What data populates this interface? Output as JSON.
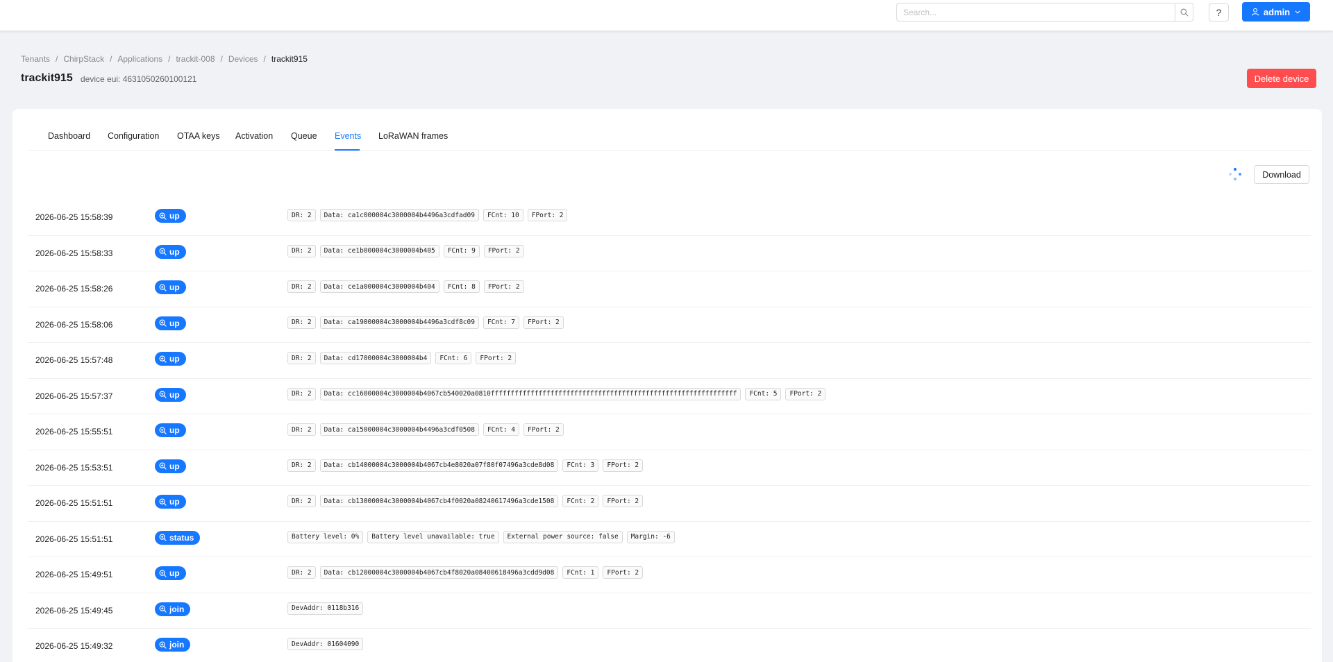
{
  "header": {
    "search_placeholder": "Search...",
    "help_label": "?",
    "user_label": "admin"
  },
  "breadcrumb": [
    "Tenants",
    "ChirpStack",
    "Applications",
    "trackit-008",
    "Devices",
    "trackit915"
  ],
  "page": {
    "title": "trackit915",
    "subtitle": "device eui: 4631050260100121",
    "delete_label": "Delete device"
  },
  "tabs": [
    "Dashboard",
    "Configuration",
    "OTAA keys",
    "Activation",
    "Queue",
    "Events",
    "LoRaWAN frames"
  ],
  "active_tab": "Events",
  "download_label": "Download",
  "colors": {
    "primary": "#1677ff",
    "danger": "#ff4d4f"
  },
  "events": [
    {
      "time": "2026-06-25 15:58:39",
      "type": "up",
      "tags": [
        "DR: 2",
        "Data: ca1c000004c3000004b4496a3cdfad09",
        "FCnt: 10",
        "FPort: 2"
      ]
    },
    {
      "time": "2026-06-25 15:58:33",
      "type": "up",
      "tags": [
        "DR: 2",
        "Data: ce1b000004c3000004b405",
        "FCnt: 9",
        "FPort: 2"
      ]
    },
    {
      "time": "2026-06-25 15:58:26",
      "type": "up",
      "tags": [
        "DR: 2",
        "Data: ce1a000004c3000004b404",
        "FCnt: 8",
        "FPort: 2"
      ]
    },
    {
      "time": "2026-06-25 15:58:06",
      "type": "up",
      "tags": [
        "DR: 2",
        "Data: ca19000004c3000004b4496a3cdf8c09",
        "FCnt: 7",
        "FPort: 2"
      ]
    },
    {
      "time": "2026-06-25 15:57:48",
      "type": "up",
      "tags": [
        "DR: 2",
        "Data: cd17000004c3000004b4",
        "FCnt: 6",
        "FPort: 2"
      ]
    },
    {
      "time": "2026-06-25 15:57:37",
      "type": "up",
      "tags": [
        "DR: 2",
        "Data: cc16000004c3000004b4067cb540020a0810ffffffffffffffffffffffffffffffffffffffffffffffffffffffffffffff",
        "FCnt: 5",
        "FPort: 2"
      ]
    },
    {
      "time": "2026-06-25 15:55:51",
      "type": "up",
      "tags": [
        "DR: 2",
        "Data: ca15000004c3000004b4496a3cdf0508",
        "FCnt: 4",
        "FPort: 2"
      ]
    },
    {
      "time": "2026-06-25 15:53:51",
      "type": "up",
      "tags": [
        "DR: 2",
        "Data: cb14000004c3000004b4067cb4e8020a07f80f07496a3cde8d08",
        "FCnt: 3",
        "FPort: 2"
      ]
    },
    {
      "time": "2026-06-25 15:51:51",
      "type": "up",
      "tags": [
        "DR: 2",
        "Data: cb13000004c3000004b4067cb4f0020a08240617496a3cde1508",
        "FCnt: 2",
        "FPort: 2"
      ]
    },
    {
      "time": "2026-06-25 15:51:51",
      "type": "status",
      "tags": [
        "Battery level: 0%",
        "Battery level unavailable: true",
        "External power source: false",
        "Margin: -6"
      ]
    },
    {
      "time": "2026-06-25 15:49:51",
      "type": "up",
      "tags": [
        "DR: 2",
        "Data: cb12000004c3000004b4067cb4f8020a08400618496a3cdd9d08",
        "FCnt: 1",
        "FPort: 2"
      ]
    },
    {
      "time": "2026-06-25 15:49:45",
      "type": "join",
      "tags": [
        "DevAddr: 0118b316"
      ]
    },
    {
      "time": "2026-06-25 15:49:32",
      "type": "join",
      "tags": [
        "DevAddr: 01604090"
      ]
    }
  ]
}
